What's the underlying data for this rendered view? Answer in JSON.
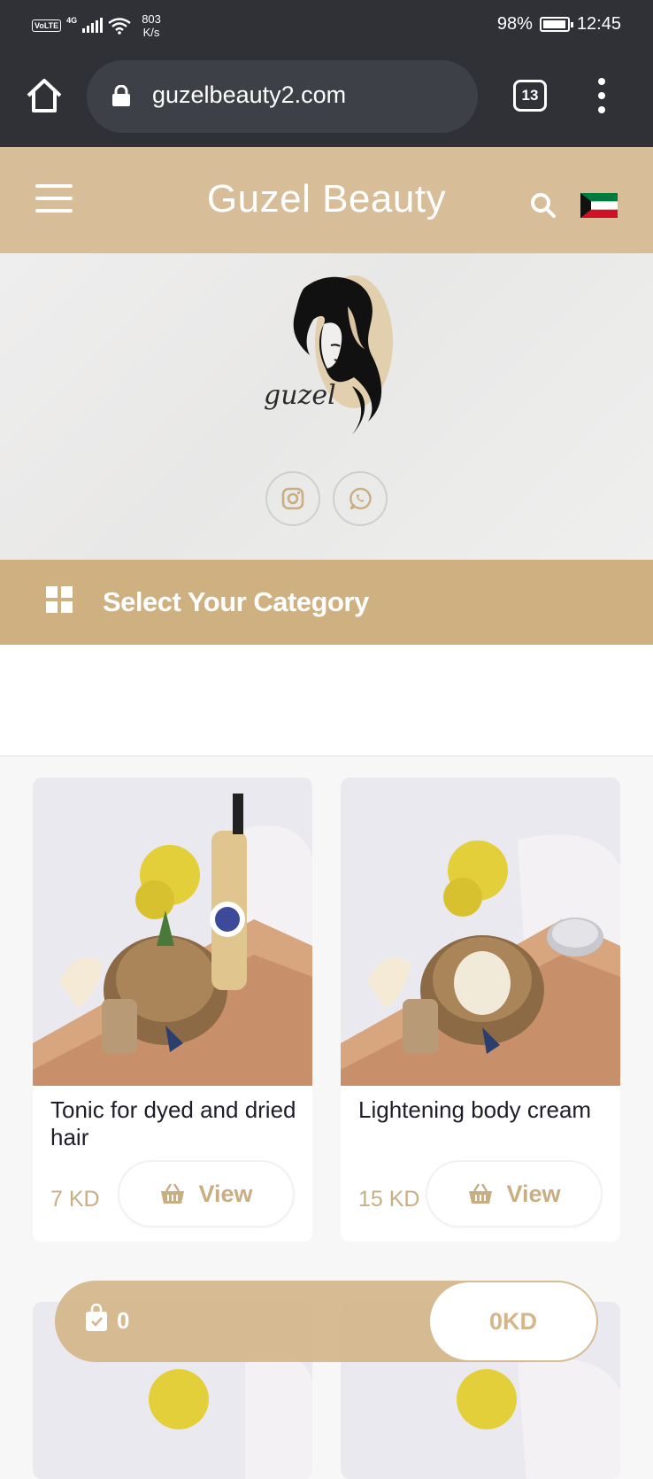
{
  "status_bar": {
    "volte": "VoLTE",
    "network": "4G",
    "speed_value": "803",
    "speed_unit": "K/s",
    "battery": "98%",
    "battery_level": 0.98,
    "time": "12:45"
  },
  "browser": {
    "url": "guzelbeauty2.com",
    "tab_count": "13"
  },
  "header": {
    "brand": "Guzel Beauty"
  },
  "hero": {
    "logo_text": "guzel"
  },
  "category_bar": {
    "label": "Select Your Category"
  },
  "products": [
    {
      "title": "Tonic for dyed and dried hair",
      "price": "7 KD",
      "view_label": "View"
    },
    {
      "title": "Lightening body cream",
      "price": "15 KD",
      "view_label": "View"
    }
  ],
  "cart": {
    "count": "0",
    "total": "0KD"
  },
  "colors": {
    "header": "#d8be98",
    "category_bar": "#cfb081",
    "accent_text": "#c9ad83",
    "chrome_dark": "#2f3136"
  }
}
